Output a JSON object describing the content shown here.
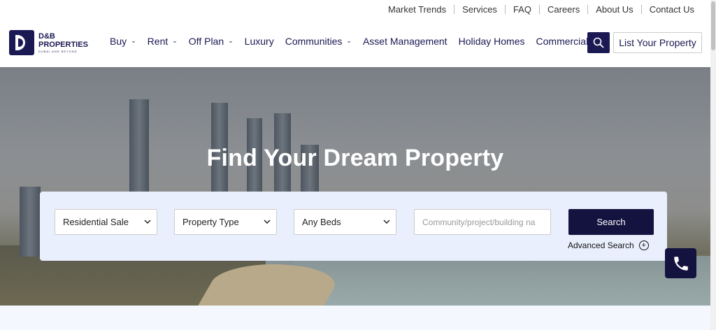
{
  "topbar": {
    "links": [
      "Market Trends",
      "Services",
      "FAQ",
      "Careers",
      "About Us",
      "Contact Us"
    ]
  },
  "logo": {
    "line1": "D&B",
    "line2": "PROPERTIES",
    "tagline": "DUBAI AND BEYOND"
  },
  "nav": {
    "items": [
      {
        "label": "Buy",
        "has_dropdown": true
      },
      {
        "label": "Rent",
        "has_dropdown": true
      },
      {
        "label": "Off Plan",
        "has_dropdown": true
      },
      {
        "label": "Luxury",
        "has_dropdown": false
      },
      {
        "label": "Communities",
        "has_dropdown": true
      },
      {
        "label": "Asset Management",
        "has_dropdown": false
      },
      {
        "label": "Holiday Homes",
        "has_dropdown": false
      },
      {
        "label": "Commercial",
        "has_dropdown": false
      }
    ],
    "search_icon": "search-icon",
    "list_property_label": "List Your Property"
  },
  "hero": {
    "title": "Find Your Dream Property"
  },
  "search": {
    "category_value": "Residential Sale",
    "type_value": "Property Type",
    "beds_value": "Any Beds",
    "location_placeholder": "Community/project/building na",
    "submit_label": "Search",
    "advanced_label": "Advanced Search"
  },
  "colors": {
    "brand": "#1b1953",
    "button": "#14123f",
    "panel": "#e9effc"
  },
  "floating": {
    "phone_icon": "phone-icon"
  }
}
